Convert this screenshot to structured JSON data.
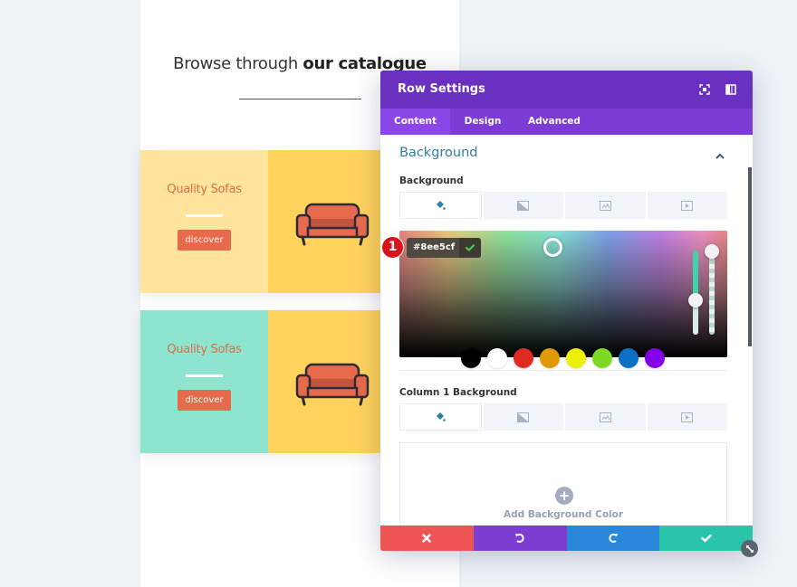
{
  "page": {
    "heading_light": "Browse through ",
    "heading_bold": "our catalogue",
    "cards": [
      {
        "title": "Quality Sofas",
        "button": "discover",
        "left_bg": "#ffe49b",
        "right_bg": "#ffd25c"
      },
      {
        "title": "Quality Sofas",
        "button": "discover",
        "left_bg": "#8ee5cf",
        "right_bg": "#ffd25c"
      }
    ]
  },
  "modal": {
    "title": "Row Settings",
    "header_icons": [
      "focus-icon",
      "split-view-icon"
    ],
    "tabs": [
      {
        "label": "Content",
        "active": true
      },
      {
        "label": "Design",
        "active": false
      },
      {
        "label": "Advanced",
        "active": false
      }
    ],
    "section_title": "Background",
    "background": {
      "label": "Background",
      "type_tabs": [
        "color",
        "gradient",
        "image",
        "video"
      ],
      "active_type": "color",
      "hex_value": "#8ee5cf",
      "swatches": [
        "#000000",
        "#ffffff",
        "#e02b20",
        "#e09900",
        "#edf000",
        "#7cda24",
        "#0c71c3",
        "#8300e9"
      ]
    },
    "column1": {
      "label": "Column 1 Background",
      "type_tabs": [
        "color",
        "gradient",
        "image",
        "video"
      ],
      "active_type": "color",
      "add_label": "Add Background Color"
    },
    "footer": [
      {
        "action": "cancel",
        "color": "#ef5555"
      },
      {
        "action": "undo",
        "color": "#7b3ed1"
      },
      {
        "action": "redo",
        "color": "#2b87da"
      },
      {
        "action": "save",
        "color": "#29c4a9"
      }
    ],
    "colors": {
      "header": "#6a30c0",
      "tabs": "#7d3bd6",
      "tab_active": "#8a46e6",
      "section_title": "#2e7fa8"
    }
  },
  "annotation": {
    "badge_number": "1"
  }
}
